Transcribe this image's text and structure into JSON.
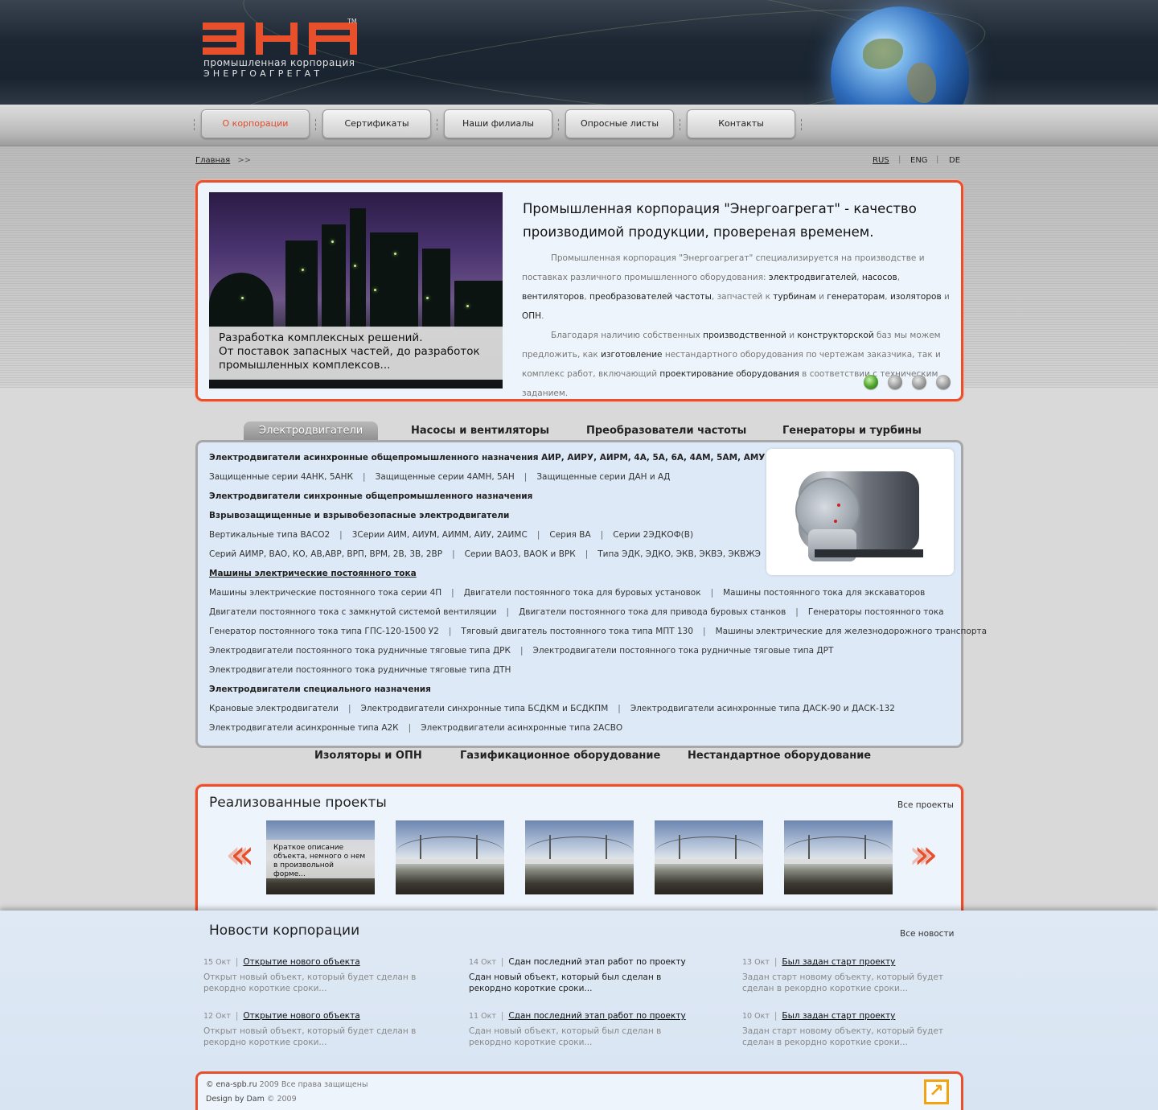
{
  "brand": {
    "tm": "TM",
    "line1": "промышленная корпорация",
    "line2": "ЭНЕРГОАГРЕГАТ",
    "accent": "#e8502c"
  },
  "nav": {
    "items": [
      {
        "label": "О корпорации",
        "active": true
      },
      {
        "label": "Сертификаты"
      },
      {
        "label": "Наши филиалы"
      },
      {
        "label": "Опросные листы"
      },
      {
        "label": "Контакты"
      }
    ]
  },
  "breadcrumb": {
    "home": "Главная",
    "sep": ">>"
  },
  "lang": {
    "rus": "RUS",
    "eng": "ENG",
    "de": "DE",
    "sep": "|"
  },
  "feature": {
    "caption": [
      "Разработка комплексных решений.",
      "От поставок запасных частей, до разработок",
      "промышленных комплексов..."
    ],
    "title": "Промышленная корпорация \"Энергоагрегат\" - качество производимой продукции, провереная временем.",
    "p1": {
      "t1": "Промышленная корпорация \"Энергоагрегат\" специализируется на производстве и поставках различного промышленного оборудования: ",
      "b1": "электродвигателей",
      "t2": ", ",
      "b2": "насосов",
      "t3": ", ",
      "b3": "вентиляторов",
      "t4": ", ",
      "b4": "преобразователей частоты",
      "t5": ", запчастей к ",
      "b5": "турбинам",
      "t6": " и ",
      "b6": "генераторам",
      "t7": ", ",
      "b7": "изоляторов",
      "t8": " и ",
      "b8": "ОПН",
      "t9": "."
    },
    "p2": {
      "t1": "Благодаря наличию собственных ",
      "b1": "производственной",
      "t2": " и ",
      "b2": "конструкторской",
      "t3": " баз мы можем предложить, как ",
      "b3": "изготовление",
      "t4": " нестандартного оборудования по чертежам заказчика, так и комплекс работ, включающий ",
      "b4": "проектирование оборудования",
      "t5": " в соответствии с техническим заданием."
    },
    "slides": 4,
    "active_slide": 1
  },
  "categories": {
    "tabs": [
      "Электродвигатели",
      "Насосы и вентиляторы",
      "Преобразователи частоты",
      "Генераторы и турбины"
    ],
    "bottom_tabs": [
      "Изоляторы и ОПН",
      "Газификационное оборудование",
      "Нестандартное оборудование"
    ],
    "rows": [
      {
        "type": "h",
        "items": [
          "Электродвигатели асинхронные общепромышленного назначения  АИР, АИРУ, АИРМ, 4А, 5А, 6А, 4АМ, 5АМ, АМУ"
        ]
      },
      {
        "type": "l",
        "items": [
          "Защищенные серии 4АНК, 5АНК",
          "Защищенные серии 4АМН, 5АН",
          "Защищенные серии ДАН и АД"
        ]
      },
      {
        "type": "h",
        "items": [
          "Электродвигатели синхронные общепромышленного назначения"
        ]
      },
      {
        "type": "h",
        "items": [
          "Взрывозащищенные и взрывобезопасные электродвигатели"
        ]
      },
      {
        "type": "l",
        "items": [
          "Вертикальные типа ВАСО2",
          "3Серии АИМ, АИУМ, АИММ, АИУ, 2АИМС",
          "Серия ВА",
          "Серии 2ЭДКОФ(В)"
        ]
      },
      {
        "type": "l",
        "items": [
          "Серий АИМР, ВАО, КО, АВ,АВР, ВРП, ВРМ, 2В, 3В, 2ВР",
          "Серии ВАО3, ВАОК и ВРК",
          "Типа ЭДК, ЭДКО, ЭКВ, ЭКВЭ, ЭКВЖЭ"
        ]
      },
      {
        "type": "u",
        "items": [
          "Машины электрические постоянного тока"
        ]
      },
      {
        "type": "l",
        "items": [
          "Машины электрические постоянного тока серии 4П",
          "Двигатели постоянного тока для буровых установок",
          "Машины постоянного тока для экскаваторов"
        ]
      },
      {
        "type": "l",
        "items": [
          "Двигатели постоянного тока с замкнутой системой вентиляции",
          "Двигатели постоянного тока для привода буровых станков",
          "Генераторы постоянного тока"
        ]
      },
      {
        "type": "l",
        "items": [
          "Генератор постоянного тока типа ГПС-120-1500 У2",
          "Тяговый двигатель постоянного тока типа МПТ 130",
          "Машины электрические для железнодорожного транспорта"
        ]
      },
      {
        "type": "l",
        "items": [
          "Электродвигатели постоянного тока рудничные тяговые типа ДРК",
          "Электродвигатели постоянного тока рудничные тяговые типа ДРТ"
        ]
      },
      {
        "type": "l",
        "items": [
          "Электродвигатели постоянного тока рудничные тяговые типа ДТН"
        ]
      },
      {
        "type": "h",
        "items": [
          "Электродвигатели специального назначения"
        ]
      },
      {
        "type": "l",
        "items": [
          "Крановые электродвигатели",
          "Электродвигатели синхронные типа БСДКМ и БСДКПМ",
          "Электродвигатели асинхронные типа ДАСК-90 и ДАСК-132"
        ]
      },
      {
        "type": "l",
        "items": [
          "Электродвигатели асинхронные типа А2К",
          "Электродвигатели асинхронные типа 2АСВО"
        ]
      }
    ]
  },
  "projects": {
    "title": "Реализованные проекты",
    "all": "Все проекты",
    "prev": "«",
    "next": "»",
    "caption": "Краткое описание объекта, немного о нем в произвольной форме..."
  },
  "news": {
    "title": "Новости корпорации",
    "all": "Все новости",
    "items": [
      {
        "date": "15 Окт",
        "title": "Открытие нового объекта",
        "body": "Открыт новый объект, который будет сделан в рекордно короткие сроки..."
      },
      {
        "date": "14 Окт",
        "title": "Сдан последний этап работ по проекту",
        "body": "Сдан новый объект, который был сделан в рекордно короткие сроки..."
      },
      {
        "date": "13 Окт",
        "title": "Был задан старт проекту",
        "body": "Задан старт новому объекту, который будет сделан в рекордно короткие сроки..."
      },
      {
        "date": "12 Окт",
        "title": "Открытие нового объекта",
        "body": "Открыт новый объект, который будет сделан в рекордно короткие сроки..."
      },
      {
        "date": "11 Окт",
        "title": "Сдан последний этап работ по проекту",
        "body": "Сдан новый объект, который был сделан в рекордно короткие сроки..."
      },
      {
        "date": "10 Окт",
        "title": "Был задан старт проекту",
        "body": "Задан старт новому объекту, который будет сделан в рекордно короткие сроки..."
      }
    ]
  },
  "footer": {
    "copy_sym": "©",
    "site": "ena-spb.ru",
    "rights": "2009 Все права защищены",
    "design": "Design by Dam",
    "design_year": "2009"
  }
}
